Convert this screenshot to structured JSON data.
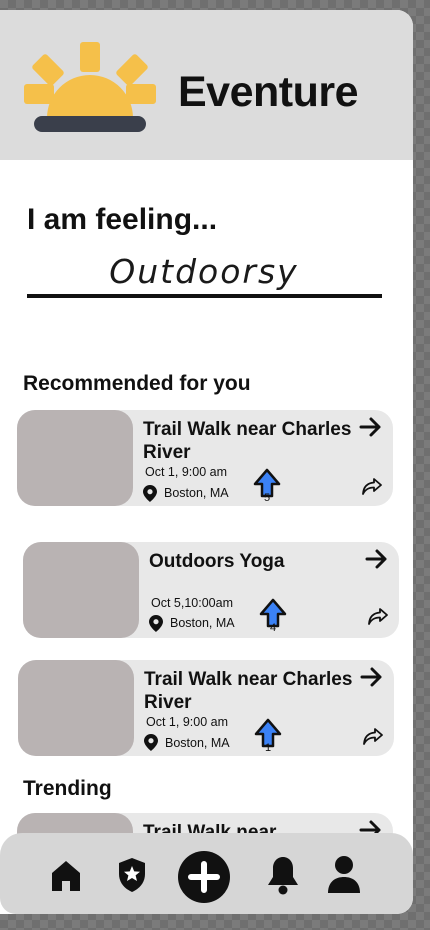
{
  "app": {
    "title": "Eventure"
  },
  "mood": {
    "label": "I am feeling...",
    "value": "Outdoorsy"
  },
  "recommended": {
    "title": "Recommended for you",
    "cards": [
      {
        "title": "Trail Walk near Charles River",
        "date": "Oct 1, 9:00 am",
        "location": "Boston, MA",
        "votes": "5"
      },
      {
        "title": "Outdoors Yoga",
        "date": "Oct 5,10:00am",
        "location": "Boston, MA",
        "votes": "4"
      },
      {
        "title": "Trail Walk near Charles River",
        "date": "Oct 1, 9:00 am",
        "location": "Boston, MA",
        "votes": "1"
      }
    ]
  },
  "trending": {
    "title": "Trending",
    "cards": [
      {
        "title": "Trail Walk near"
      }
    ]
  },
  "nav": {
    "items": [
      "home-icon",
      "badge-star-icon",
      "add-icon",
      "bell-icon",
      "profile-icon"
    ]
  },
  "colors": {
    "header_bg": "#dcdcdc",
    "sun": "#f5c04a",
    "upvote_blue": "#3b82f6",
    "card_bg": "#e8e8e8",
    "thumb": "#b9b3b3"
  }
}
